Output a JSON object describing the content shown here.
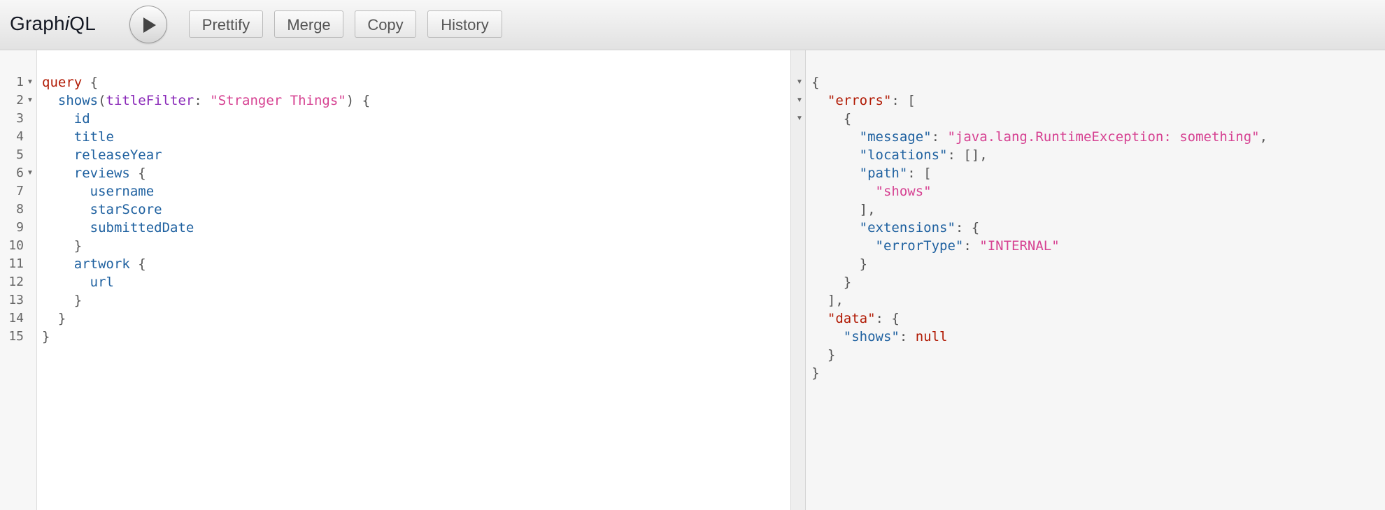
{
  "app": {
    "title_prefix": "Graph",
    "title_i": "i",
    "title_suffix": "QL"
  },
  "toolbar": {
    "run_label": "Execute query",
    "prettify": "Prettify",
    "merge": "Merge",
    "copy": "Copy",
    "history": "History"
  },
  "icons": {
    "run": "play-icon",
    "fold": "fold-arrow-icon"
  },
  "colors": {
    "keyword": "#b11a04",
    "field": "#1f61a0",
    "argument": "#8b2bb9",
    "string": "#d64292",
    "punctuation": "#555555"
  },
  "query_editor": {
    "line_numbers": [
      "1",
      "2",
      "3",
      "4",
      "5",
      "6",
      "7",
      "8",
      "9",
      "10",
      "11",
      "12",
      "13",
      "14",
      "15"
    ],
    "lines": [
      {
        "indent": "",
        "tokens": [
          {
            "c": "kw",
            "t": "query"
          },
          {
            "c": "pun",
            "t": " {"
          }
        ]
      },
      {
        "indent": "  ",
        "tokens": [
          {
            "c": "fld",
            "t": "shows"
          },
          {
            "c": "pun",
            "t": "("
          },
          {
            "c": "arg",
            "t": "titleFilter"
          },
          {
            "c": "pun",
            "t": ": "
          },
          {
            "c": "str",
            "t": "\"Stranger Things\""
          },
          {
            "c": "pun",
            "t": ") {"
          }
        ]
      },
      {
        "indent": "    ",
        "tokens": [
          {
            "c": "fld",
            "t": "id"
          }
        ]
      },
      {
        "indent": "    ",
        "tokens": [
          {
            "c": "fld",
            "t": "title"
          }
        ]
      },
      {
        "indent": "    ",
        "tokens": [
          {
            "c": "fld",
            "t": "releaseYear"
          }
        ]
      },
      {
        "indent": "    ",
        "tokens": [
          {
            "c": "fld",
            "t": "reviews"
          },
          {
            "c": "pun",
            "t": " {"
          }
        ]
      },
      {
        "indent": "      ",
        "tokens": [
          {
            "c": "fld",
            "t": "username"
          }
        ]
      },
      {
        "indent": "      ",
        "tokens": [
          {
            "c": "fld",
            "t": "starScore"
          }
        ]
      },
      {
        "indent": "      ",
        "tokens": [
          {
            "c": "fld",
            "t": "submittedDate"
          }
        ]
      },
      {
        "indent": "    ",
        "tokens": [
          {
            "c": "pun",
            "t": "}"
          }
        ]
      },
      {
        "indent": "    ",
        "tokens": [
          {
            "c": "fld",
            "t": "artwork"
          },
          {
            "c": "pun",
            "t": " {"
          }
        ]
      },
      {
        "indent": "      ",
        "tokens": [
          {
            "c": "fld",
            "t": "url"
          }
        ]
      },
      {
        "indent": "    ",
        "tokens": [
          {
            "c": "pun",
            "t": "}"
          }
        ]
      },
      {
        "indent": "  ",
        "tokens": [
          {
            "c": "pun",
            "t": "}"
          }
        ]
      },
      {
        "indent": "",
        "tokens": [
          {
            "c": "pun",
            "t": "}"
          }
        ]
      }
    ],
    "fold_lines": [
      1,
      2,
      6
    ]
  },
  "result_viewer": {
    "lines": [
      {
        "indent": "",
        "tokens": [
          {
            "c": "pun",
            "t": "{"
          }
        ]
      },
      {
        "indent": "  ",
        "tokens": [
          {
            "c": "kw",
            "t": "\"errors\""
          },
          {
            "c": "pun",
            "t": ": ["
          }
        ]
      },
      {
        "indent": "    ",
        "tokens": [
          {
            "c": "pun",
            "t": "{"
          }
        ]
      },
      {
        "indent": "      ",
        "tokens": [
          {
            "c": "fld",
            "t": "\"message\""
          },
          {
            "c": "pun",
            "t": ": "
          },
          {
            "c": "str",
            "t": "\"java.lang.RuntimeException: something\""
          },
          {
            "c": "pun",
            "t": ","
          }
        ]
      },
      {
        "indent": "      ",
        "tokens": [
          {
            "c": "fld",
            "t": "\"locations\""
          },
          {
            "c": "pun",
            "t": ": [],"
          }
        ]
      },
      {
        "indent": "      ",
        "tokens": [
          {
            "c": "fld",
            "t": "\"path\""
          },
          {
            "c": "pun",
            "t": ": ["
          }
        ]
      },
      {
        "indent": "        ",
        "tokens": [
          {
            "c": "str",
            "t": "\"shows\""
          }
        ]
      },
      {
        "indent": "      ",
        "tokens": [
          {
            "c": "pun",
            "t": "],"
          }
        ]
      },
      {
        "indent": "      ",
        "tokens": [
          {
            "c": "fld",
            "t": "\"extensions\""
          },
          {
            "c": "pun",
            "t": ": {"
          }
        ]
      },
      {
        "indent": "        ",
        "tokens": [
          {
            "c": "fld",
            "t": "\"errorType\""
          },
          {
            "c": "pun",
            "t": ": "
          },
          {
            "c": "str",
            "t": "\"INTERNAL\""
          }
        ]
      },
      {
        "indent": "      ",
        "tokens": [
          {
            "c": "pun",
            "t": "}"
          }
        ]
      },
      {
        "indent": "    ",
        "tokens": [
          {
            "c": "pun",
            "t": "}"
          }
        ]
      },
      {
        "indent": "  ",
        "tokens": [
          {
            "c": "pun",
            "t": "],"
          }
        ]
      },
      {
        "indent": "  ",
        "tokens": [
          {
            "c": "kw",
            "t": "\"data\""
          },
          {
            "c": "pun",
            "t": ": {"
          }
        ]
      },
      {
        "indent": "    ",
        "tokens": [
          {
            "c": "fld",
            "t": "\"shows\""
          },
          {
            "c": "pun",
            "t": ": "
          },
          {
            "c": "nul",
            "t": "null"
          }
        ]
      },
      {
        "indent": "  ",
        "tokens": [
          {
            "c": "pun",
            "t": "}"
          }
        ]
      },
      {
        "indent": "",
        "tokens": [
          {
            "c": "pun",
            "t": "}"
          }
        ]
      }
    ],
    "fold_lines": [
      1,
      2,
      3
    ]
  }
}
